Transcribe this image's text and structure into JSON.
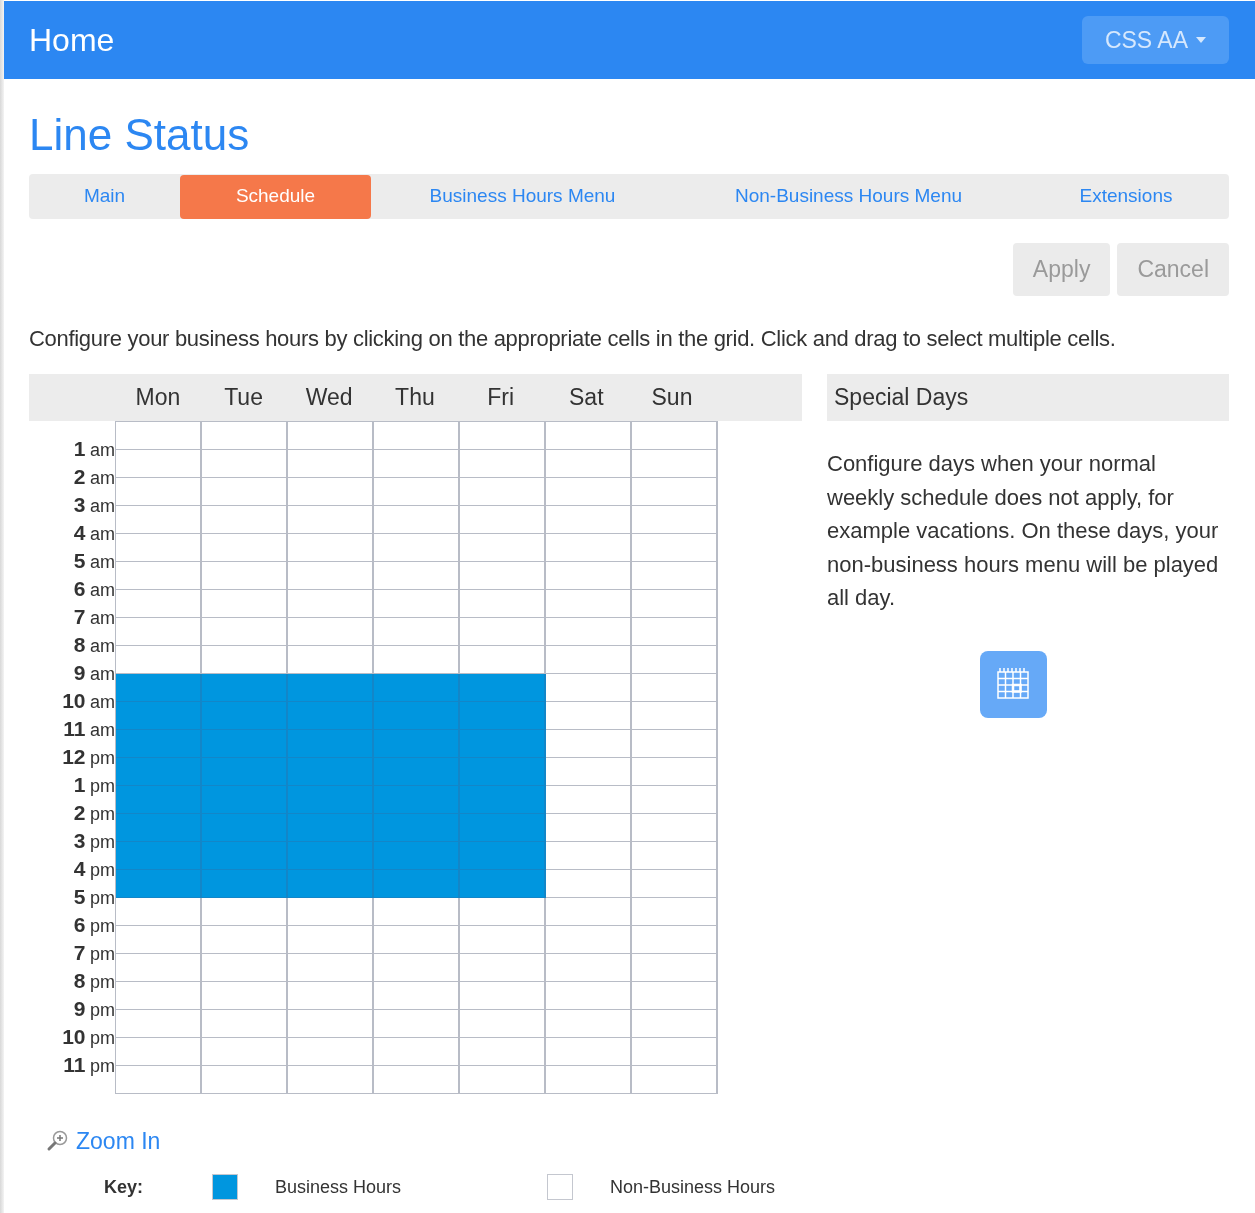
{
  "header": {
    "title": "Home",
    "menu_button": "CSS AA"
  },
  "page_title": "Line Status",
  "tabs": [
    {
      "label": "Main",
      "selected": false
    },
    {
      "label": "Schedule",
      "selected": true
    },
    {
      "label": "Business Hours Menu",
      "selected": false
    },
    {
      "label": "Non-Business Hours Menu",
      "selected": false
    },
    {
      "label": "Extensions",
      "selected": false
    }
  ],
  "actions": [
    {
      "label": "Apply",
      "disabled": true
    },
    {
      "label": "Cancel",
      "disabled": true
    }
  ],
  "instructions": "Configure your business hours by clicking on the appropriate cells in the grid. Click and drag to select multiple cells.",
  "schedule": {
    "days": [
      "Mon",
      "Tue",
      "Wed",
      "Thu",
      "Fri",
      "Sat",
      "Sun"
    ],
    "hour_labels": [
      {
        "hour": "1",
        "period": "am"
      },
      {
        "hour": "2",
        "period": "am"
      },
      {
        "hour": "3",
        "period": "am"
      },
      {
        "hour": "4",
        "period": "am"
      },
      {
        "hour": "5",
        "period": "am"
      },
      {
        "hour": "6",
        "period": "am"
      },
      {
        "hour": "7",
        "period": "am"
      },
      {
        "hour": "8",
        "period": "am"
      },
      {
        "hour": "9",
        "period": "am"
      },
      {
        "hour": "10",
        "period": "am"
      },
      {
        "hour": "11",
        "period": "am"
      },
      {
        "hour": "12",
        "period": "pm"
      },
      {
        "hour": "1",
        "period": "pm"
      },
      {
        "hour": "2",
        "period": "pm"
      },
      {
        "hour": "3",
        "period": "pm"
      },
      {
        "hour": "4",
        "period": "pm"
      },
      {
        "hour": "5",
        "period": "pm"
      },
      {
        "hour": "6",
        "period": "pm"
      },
      {
        "hour": "7",
        "period": "pm"
      },
      {
        "hour": "8",
        "period": "pm"
      },
      {
        "hour": "9",
        "period": "pm"
      },
      {
        "hour": "10",
        "period": "pm"
      },
      {
        "hour": "11",
        "period": "pm"
      }
    ],
    "rows": [
      [
        false,
        false,
        false,
        false,
        false,
        false,
        false
      ],
      [
        false,
        false,
        false,
        false,
        false,
        false,
        false
      ],
      [
        false,
        false,
        false,
        false,
        false,
        false,
        false
      ],
      [
        false,
        false,
        false,
        false,
        false,
        false,
        false
      ],
      [
        false,
        false,
        false,
        false,
        false,
        false,
        false
      ],
      [
        false,
        false,
        false,
        false,
        false,
        false,
        false
      ],
      [
        false,
        false,
        false,
        false,
        false,
        false,
        false
      ],
      [
        false,
        false,
        false,
        false,
        false,
        false,
        false
      ],
      [
        false,
        false,
        false,
        false,
        false,
        false,
        false
      ],
      [
        true,
        true,
        true,
        true,
        true,
        false,
        false
      ],
      [
        true,
        true,
        true,
        true,
        true,
        false,
        false
      ],
      [
        true,
        true,
        true,
        true,
        true,
        false,
        false
      ],
      [
        true,
        true,
        true,
        true,
        true,
        false,
        false
      ],
      [
        true,
        true,
        true,
        true,
        true,
        false,
        false
      ],
      [
        true,
        true,
        true,
        true,
        true,
        false,
        false
      ],
      [
        true,
        true,
        true,
        true,
        true,
        false,
        false
      ],
      [
        true,
        true,
        true,
        true,
        true,
        false,
        false
      ],
      [
        false,
        false,
        false,
        false,
        false,
        false,
        false
      ],
      [
        false,
        false,
        false,
        false,
        false,
        false,
        false
      ],
      [
        false,
        false,
        false,
        false,
        false,
        false,
        false
      ],
      [
        false,
        false,
        false,
        false,
        false,
        false,
        false
      ],
      [
        false,
        false,
        false,
        false,
        false,
        false,
        false
      ],
      [
        false,
        false,
        false,
        false,
        false,
        false,
        false
      ],
      [
        false,
        false,
        false,
        false,
        false,
        false,
        false
      ]
    ]
  },
  "special_days": {
    "title": "Special Days",
    "text": "Configure days when your normal weekly schedule does not apply, for example vacations. On these days, your non-business hours menu will be played all day."
  },
  "zoom_link": "Zoom In",
  "key": {
    "label": "Key:",
    "items": [
      {
        "label": "Business Hours",
        "kind": "business"
      },
      {
        "label": "Non-Business Hours",
        "kind": "nonbusiness"
      }
    ]
  }
}
